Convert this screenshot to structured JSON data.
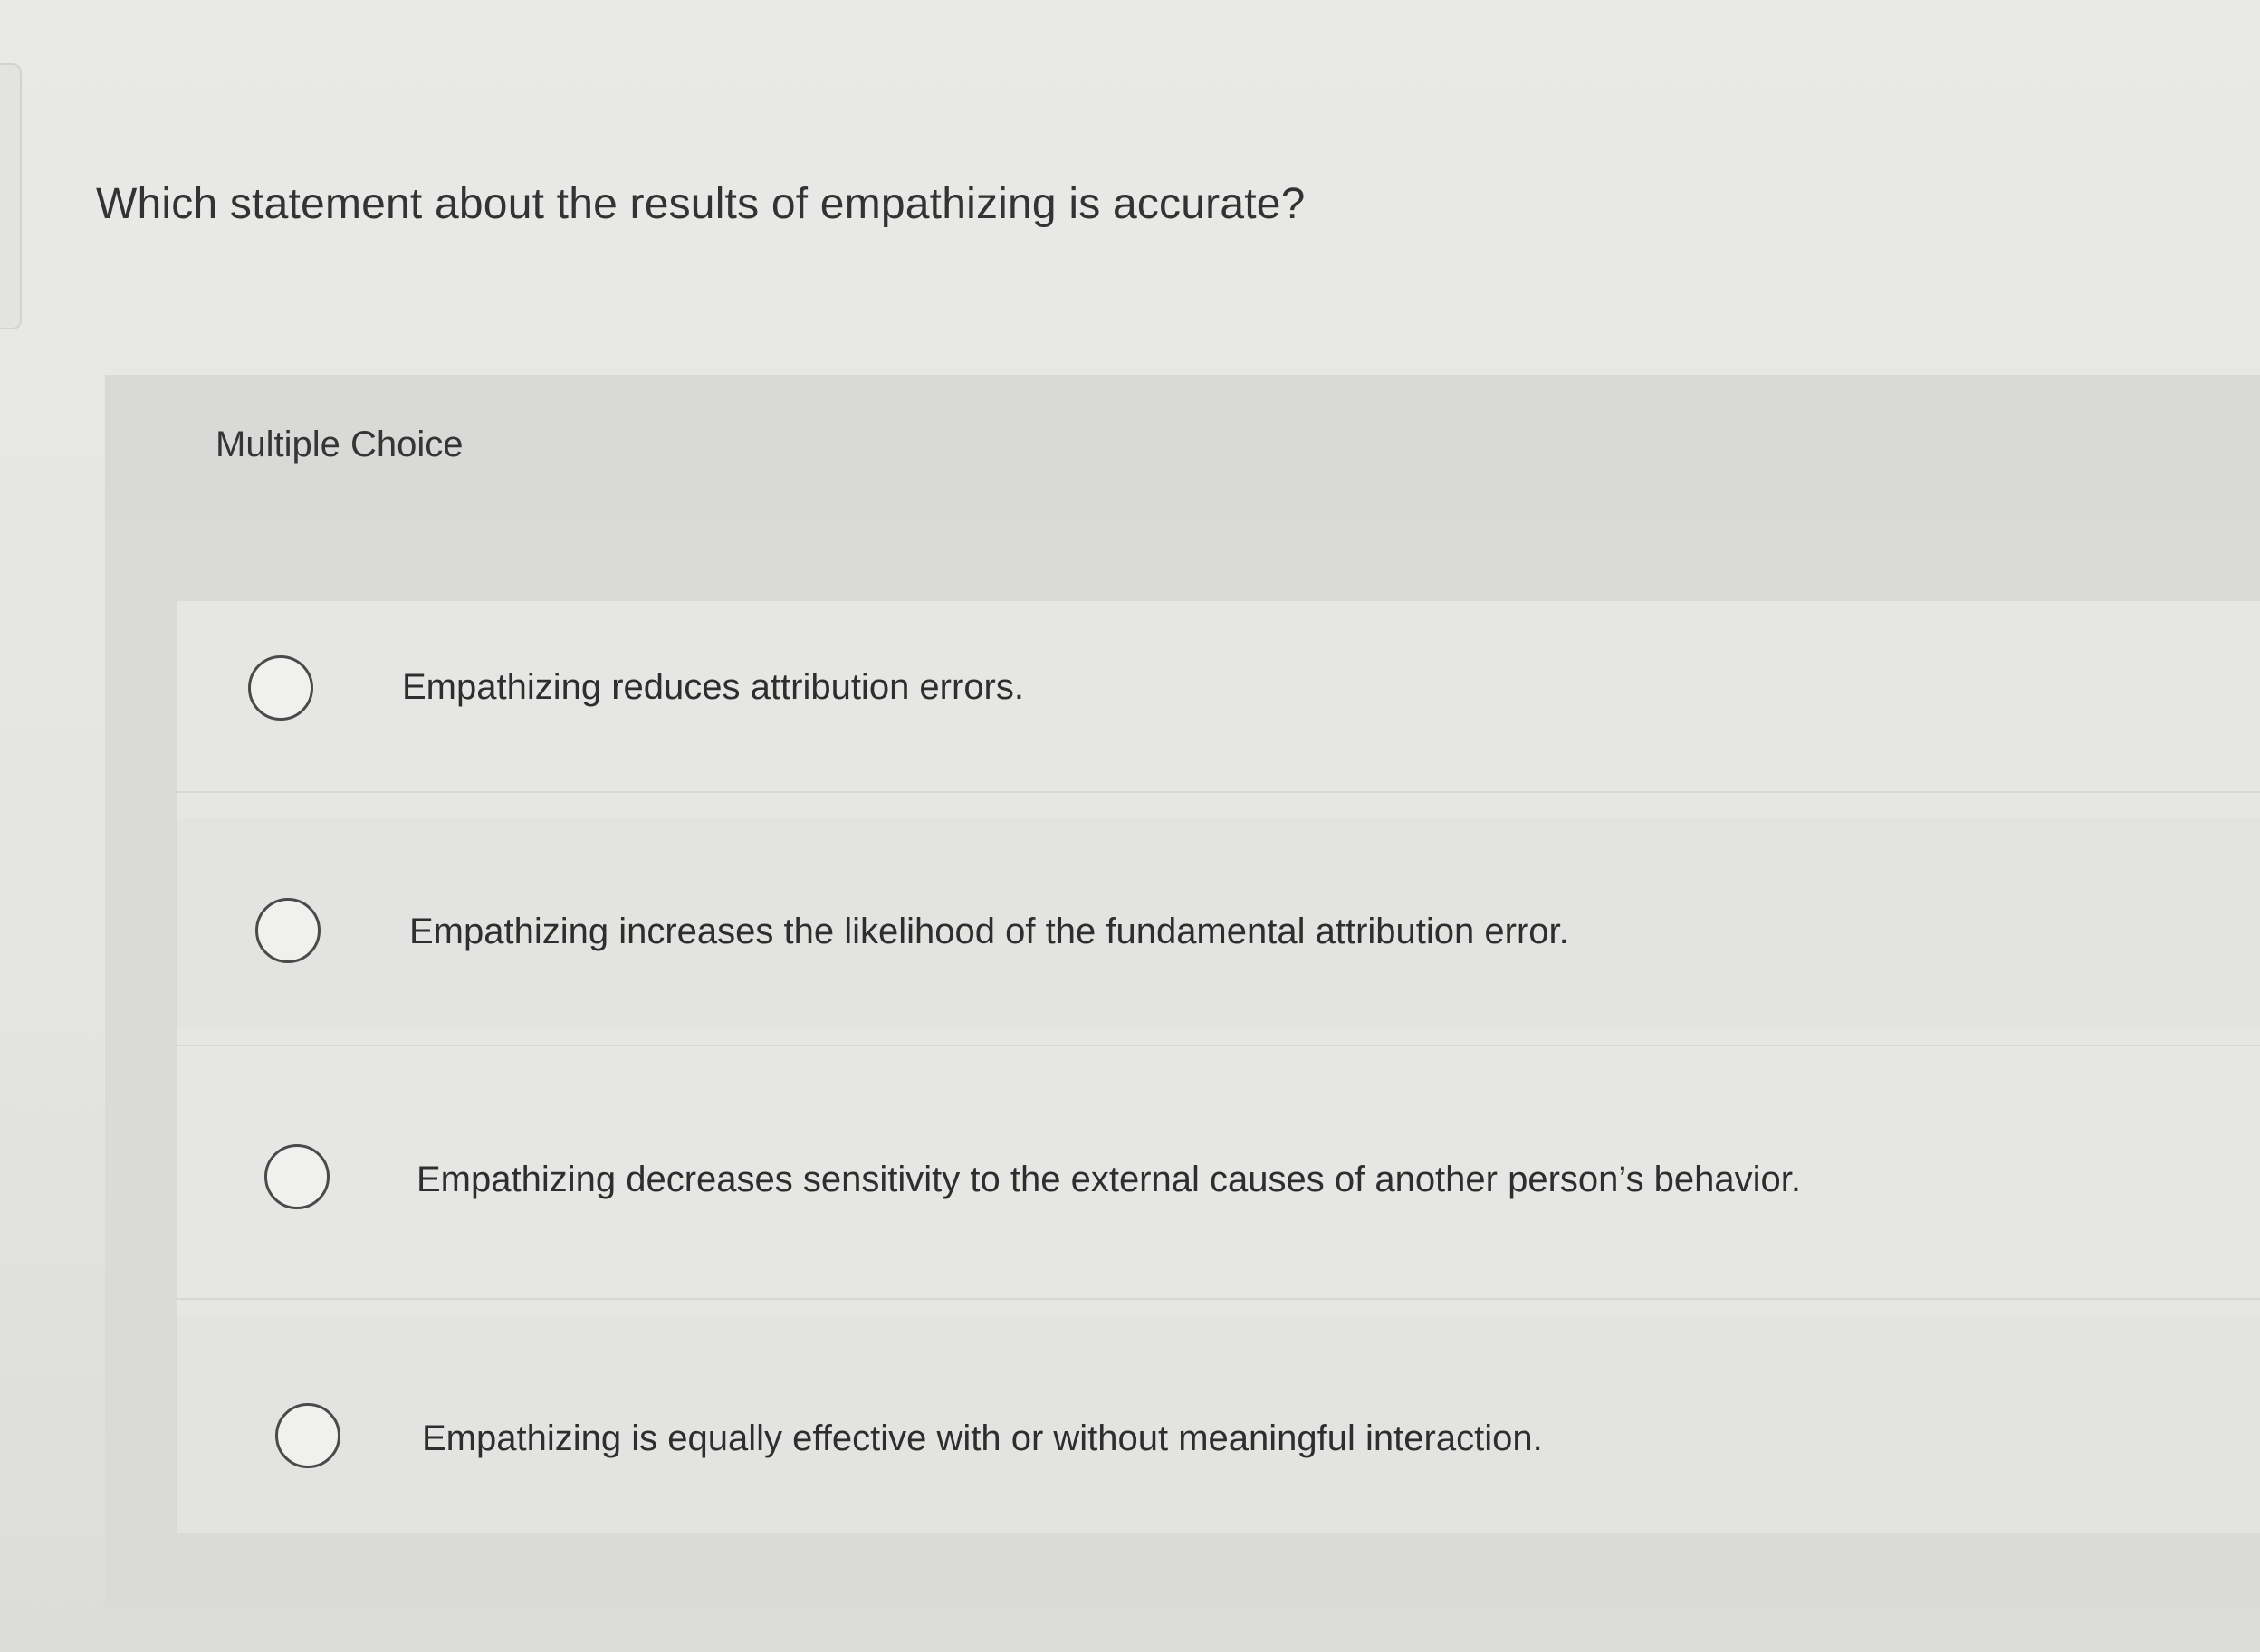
{
  "question": {
    "text": "Which statement about the results of empathizing is accurate?"
  },
  "panel": {
    "title": "Multiple Choice"
  },
  "choices": [
    {
      "label": "Empathizing reduces attribution errors."
    },
    {
      "label": "Empathizing increases the likelihood of the fundamental attribution error."
    },
    {
      "label": "Empathizing decreases sensitivity to the external causes of another person’s behavior."
    },
    {
      "label": "Empathizing is equally effective with or without meaningful interaction."
    }
  ]
}
